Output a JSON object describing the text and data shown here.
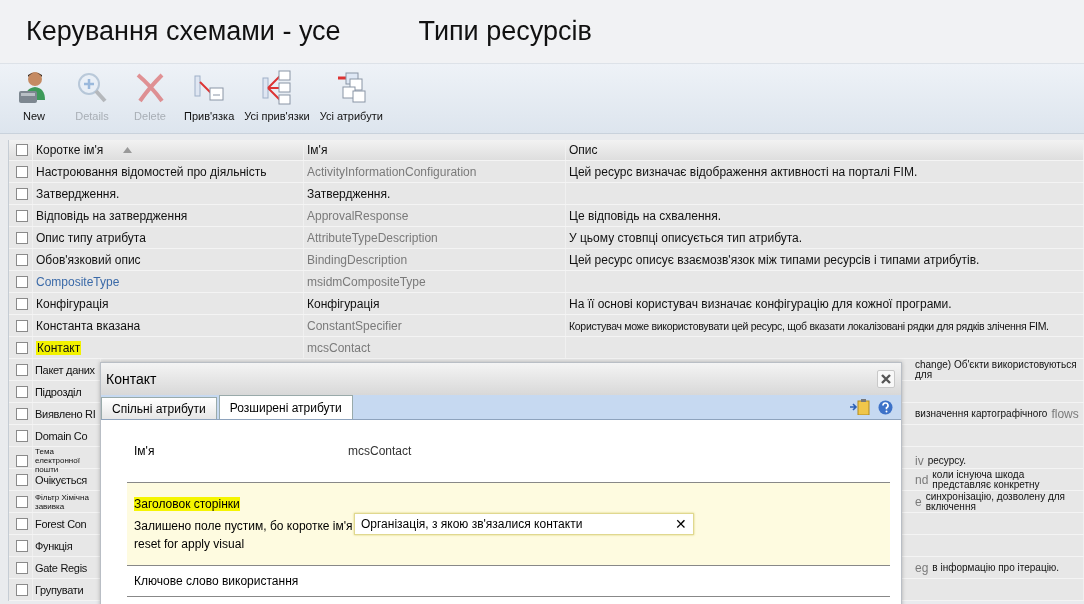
{
  "header": {
    "title": "Керування схемами - усе",
    "subtitle": "Типи ресурсів"
  },
  "toolbar": {
    "buttons": [
      {
        "label": "New",
        "disabled": false
      },
      {
        "label": "Details",
        "disabled": true
      },
      {
        "label": "Delete",
        "disabled": true
      },
      {
        "label": "Прив'язка",
        "disabled": false
      },
      {
        "label": "Усі прив'язки",
        "disabled": false
      },
      {
        "label": "Усі атрибути",
        "disabled": false
      }
    ]
  },
  "grid": {
    "header_checkbox": {
      "checked": false
    },
    "columns": [
      {
        "label": "Коротке ім'я",
        "sorted": true
      },
      {
        "label": "Ім'я",
        "sorted": false
      },
      {
        "label": "Опис",
        "sorted": false
      }
    ],
    "rows": [
      {
        "kind": "full",
        "checked": false,
        "short_name": "Настроювання відомостей про діяльність",
        "short_link": false,
        "highlighted": false,
        "name": "ActivityInformationConfiguration",
        "name_muted": true,
        "description": "Цей ресурс визначає відображення активності на порталі FIM."
      },
      {
        "kind": "full",
        "checked": false,
        "short_name": "Затвердження.",
        "short_link": false,
        "highlighted": false,
        "name": "Затвердження.",
        "name_muted": false
      },
      {
        "kind": "full",
        "checked": false,
        "short_name": "Відповідь на затвердження",
        "short_link": false,
        "highlighted": false,
        "name": "ApprovalResponse",
        "name_muted": true,
        "description": "Це відповідь на схвалення."
      },
      {
        "kind": "full",
        "checked": false,
        "short_name": "Опис типу атрибута",
        "short_link": false,
        "highlighted": false,
        "name": "AttributeTypeDescription",
        "name_muted": true,
        "description": "У цьому стовпці описується тип атрибута."
      },
      {
        "kind": "full",
        "checked": false,
        "short_name": "Обов'язковий опис",
        "short_link": false,
        "highlighted": false,
        "name": "BindingDescription",
        "name_muted": true,
        "description": "Цей ресурс описує взаємозв'язок між типами ресурсів і типами атрибутів."
      },
      {
        "kind": "full",
        "checked": false,
        "short_name": "CompositeType",
        "short_link": true,
        "highlighted": false,
        "name": "msidmCompositeType",
        "name_muted": true
      },
      {
        "kind": "full",
        "checked": false,
        "short_name": "Конфігурація",
        "short_link": false,
        "highlighted": false,
        "name": "Конфігурація",
        "name_muted": false,
        "description": "На її основі користувач визначає конфігурацію для кожної програми."
      },
      {
        "kind": "full",
        "checked": false,
        "short_name": "Константа вказана",
        "short_link": false,
        "highlighted": false,
        "name": "ConstantSpecifier",
        "name_muted": true,
        "description": "Користувач може використовувати цей ресурс, щоб вказати локалізовані рядки для рядків злічення FIM."
      },
      {
        "kind": "full",
        "checked": false,
        "short_name": "Контакт",
        "short_link": false,
        "highlighted": true,
        "name": "mcsContact",
        "name_muted": true
      },
      {
        "kind": "covered",
        "checked": false,
        "short_name": "Пакет даних",
        "tail": [
          {
            "text": "change) Об'єкти використовуються для",
            "muted": false
          }
        ]
      },
      {
        "kind": "covered",
        "checked": false,
        "short_name": "Підрозділ",
        "tail": []
      },
      {
        "kind": "covered",
        "checked": false,
        "short_name": "Виявлено RI",
        "tail": [
          {
            "text": "визначення картографічного",
            "muted": false
          },
          {
            "text": "flows",
            "muted": true
          }
        ]
      },
      {
        "kind": "covered",
        "checked": false,
        "short_name": "Domain Co",
        "tail": []
      },
      {
        "kind": "covered-small",
        "checked": false,
        "short_name": "Тема електронної пошти",
        "tail": [
          {
            "text": "iv",
            "muted": true
          },
          {
            "text": "ресурсу.",
            "muted": false
          }
        ]
      },
      {
        "kind": "covered",
        "checked": false,
        "short_name": "Очікується",
        "tail": [
          {
            "text": "nd",
            "muted": true
          },
          {
            "text": "коли існуюча шкода представляє конкретну",
            "muted": false
          }
        ]
      },
      {
        "kind": "covered-small",
        "checked": false,
        "short_name": "Фільтр Хімічна завивка",
        "tail": [
          {
            "text": "e",
            "muted": true
          },
          {
            "text": "синхронізацію, дозволену для включення",
            "muted": false
          }
        ]
      },
      {
        "kind": "covered",
        "checked": false,
        "short_name": "Forest Con",
        "tail": []
      },
      {
        "kind": "covered",
        "checked": false,
        "short_name": "Функція",
        "tail": []
      },
      {
        "kind": "covered",
        "checked": false,
        "short_name": "Gate Regis",
        "tail": [
          {
            "text": "eg",
            "muted": true
          },
          {
            "text": "в інформацію про ітерацію.",
            "muted": false
          }
        ]
      },
      {
        "kind": "covered",
        "checked": false,
        "short_name": "Групувати",
        "tail": []
      }
    ]
  },
  "dialog": {
    "title": "Контакт",
    "tabs": [
      {
        "label": "Спільні атрибути",
        "selected": false
      },
      {
        "label": "Розширені атрибути",
        "selected": true
      }
    ],
    "fields": [
      {
        "kind": "plain",
        "label": "Ім'я",
        "value": "mcsContact"
      },
      {
        "kind": "edit",
        "label": "Заголовок сторінки",
        "highlighted": true,
        "hint_lines": [
          "Залишено поле пустим, бо коротке ім'я",
          "reset for apply visual"
        ],
        "value": "Організація, з якою зв'язалися контакти",
        "clear": "✕"
      },
      {
        "kind": "label",
        "label": "Ключове слово використання"
      }
    ]
  }
}
